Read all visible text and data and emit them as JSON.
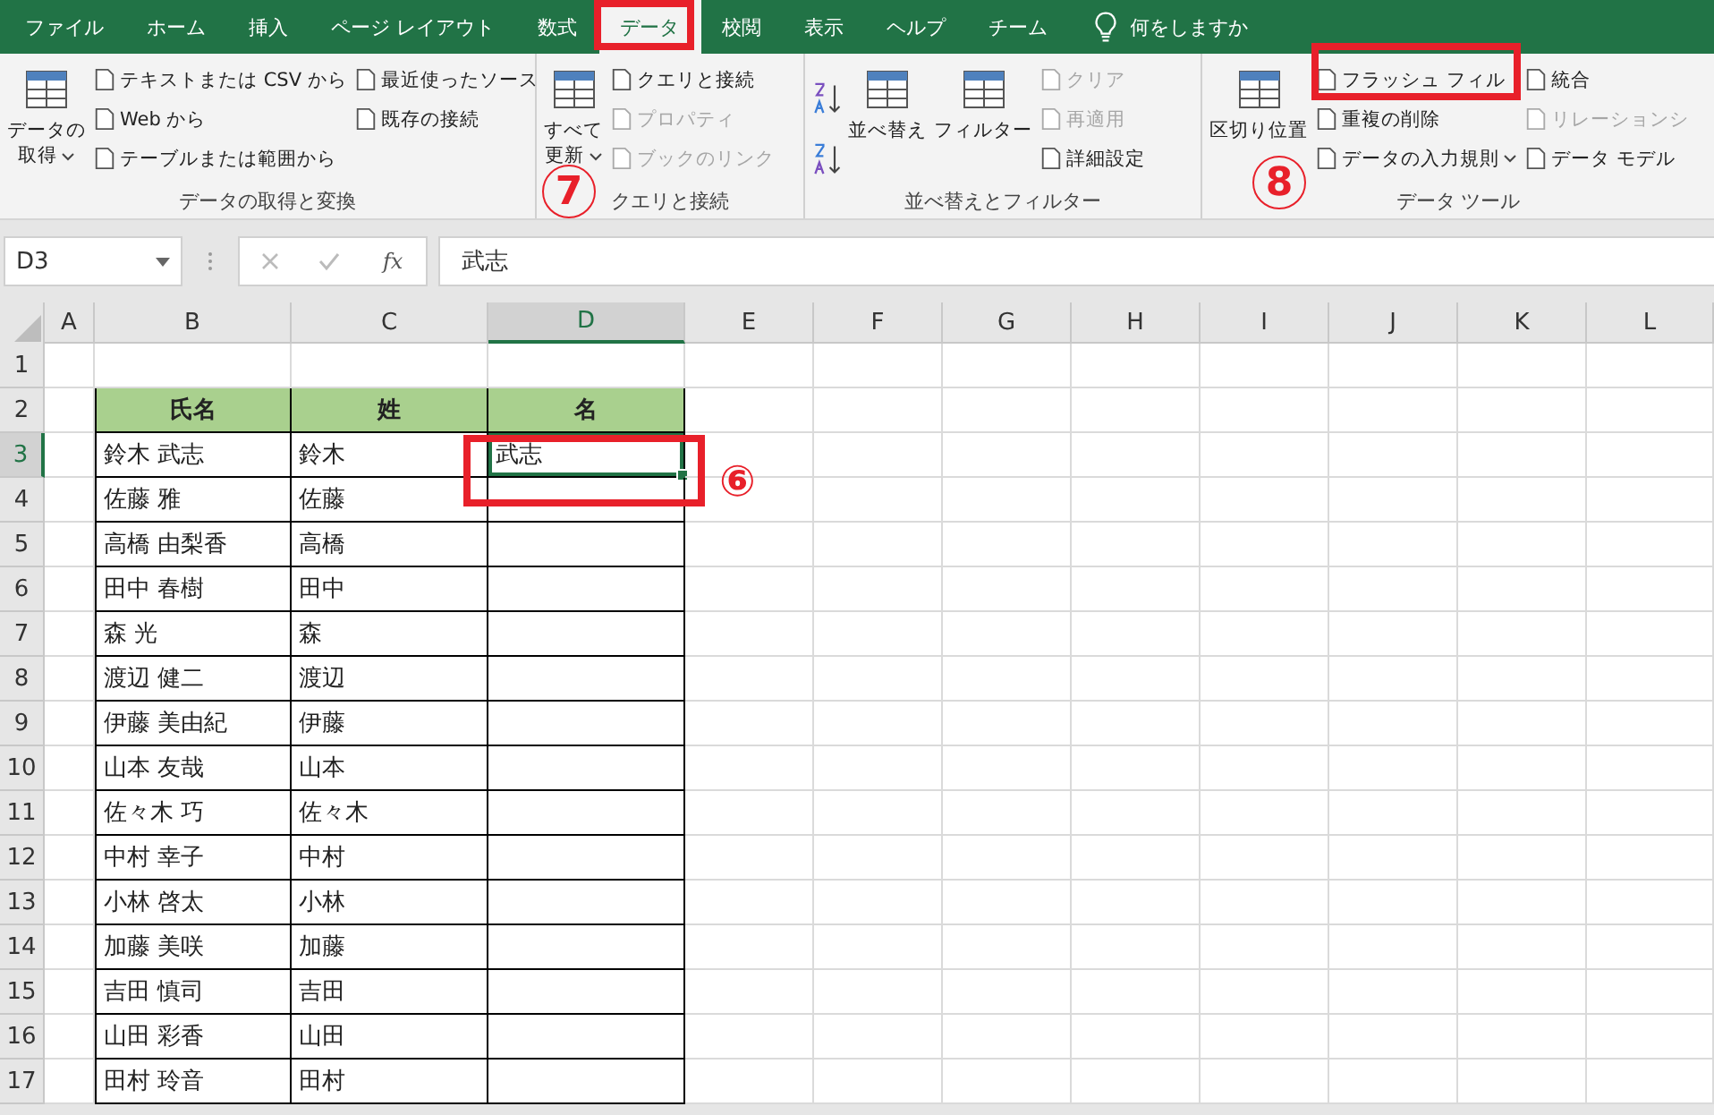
{
  "tabs": [
    {
      "label": "ファイル",
      "selected": false
    },
    {
      "label": "ホーム",
      "selected": false
    },
    {
      "label": "挿入",
      "selected": false
    },
    {
      "label": "ページ レイアウト",
      "selected": false
    },
    {
      "label": "数式",
      "selected": false
    },
    {
      "label": "データ",
      "selected": true
    },
    {
      "label": "校閲",
      "selected": false
    },
    {
      "label": "表示",
      "selected": false
    },
    {
      "label": "ヘルプ",
      "selected": false
    },
    {
      "label": "チーム",
      "selected": false
    }
  ],
  "tell_me": {
    "placeholder": "何をしますか"
  },
  "ribbon": {
    "groups": [
      {
        "label": "データの取得と変換",
        "items": [
          {
            "kind": "large",
            "label_lines": [
              "データの",
              "取得"
            ],
            "dropdown": true,
            "disabled": false
          },
          {
            "kind": "column",
            "entries": [
              {
                "label": "テキストまたは CSV から",
                "disabled": false
              },
              {
                "label": "Web から",
                "disabled": false
              },
              {
                "label": "テーブルまたは範囲から",
                "disabled": false
              }
            ]
          },
          {
            "kind": "column",
            "entries": [
              {
                "label": "最近使ったソース",
                "disabled": false
              },
              {
                "label": "既存の接続",
                "disabled": false
              }
            ]
          }
        ]
      },
      {
        "label": "クエリと接続",
        "items": [
          {
            "kind": "large",
            "label_lines": [
              "すべて",
              "更新"
            ],
            "dropdown": true,
            "disabled": false
          },
          {
            "kind": "column",
            "entries": [
              {
                "label": "クエリと接続",
                "disabled": false
              },
              {
                "label": "プロパティ",
                "disabled": true
              },
              {
                "label": "ブックのリンク",
                "disabled": true
              }
            ]
          }
        ]
      },
      {
        "label": "並べ替えとフィルター",
        "items": [
          {
            "kind": "sort_icons"
          },
          {
            "kind": "large",
            "label_lines": [
              "並べ替え"
            ],
            "dropdown": false,
            "disabled": false
          },
          {
            "kind": "large",
            "label_lines": [
              "フィルター"
            ],
            "dropdown": false,
            "disabled": false
          },
          {
            "kind": "column",
            "entries": [
              {
                "label": "クリア",
                "disabled": true
              },
              {
                "label": "再適用",
                "disabled": true
              },
              {
                "label": "詳細設定",
                "disabled": false
              }
            ]
          }
        ]
      },
      {
        "label": "データ ツール",
        "items": [
          {
            "kind": "large",
            "label_lines": [
              "区切り位置"
            ],
            "dropdown": false,
            "disabled": false
          },
          {
            "kind": "column",
            "entries": [
              {
                "label": "フラッシュ フィル",
                "disabled": false
              },
              {
                "label": "重複の削除",
                "disabled": false
              },
              {
                "label": "データの入力規則",
                "disabled": false,
                "dropdown": true
              }
            ]
          },
          {
            "kind": "column",
            "entries": [
              {
                "label": "統合",
                "disabled": false
              },
              {
                "label": "リレーションシ",
                "disabled": true
              },
              {
                "label": "データ モデル",
                "disabled": false
              }
            ]
          }
        ]
      }
    ]
  },
  "formula_bar": {
    "name_box": "D3",
    "function_label": "fx",
    "value": "武志"
  },
  "sheet": {
    "columns": [
      {
        "label": "A",
        "selected": false
      },
      {
        "label": "B",
        "selected": false
      },
      {
        "label": "C",
        "selected": false
      },
      {
        "label": "D",
        "selected": true
      },
      {
        "label": "E",
        "selected": false
      },
      {
        "label": "F",
        "selected": false
      },
      {
        "label": "G",
        "selected": false
      },
      {
        "label": "H",
        "selected": false
      },
      {
        "label": "I",
        "selected": false
      },
      {
        "label": "J",
        "selected": false
      },
      {
        "label": "K",
        "selected": false
      },
      {
        "label": "L",
        "selected": false
      }
    ],
    "rows": [
      {
        "number": "1",
        "selected": false,
        "kind": "blank",
        "cells": []
      },
      {
        "number": "2",
        "selected": false,
        "kind": "header",
        "cells": [
          "",
          "氏名",
          "姓",
          "名"
        ]
      },
      {
        "number": "3",
        "selected": true,
        "kind": "data",
        "cells": [
          "",
          "鈴木 武志",
          "鈴木",
          "武志"
        ]
      },
      {
        "number": "4",
        "selected": false,
        "kind": "data",
        "cells": [
          "",
          "佐藤 雅",
          "佐藤"
        ]
      },
      {
        "number": "5",
        "selected": false,
        "kind": "data",
        "cells": [
          "",
          "高橋 由梨香",
          "高橋"
        ]
      },
      {
        "number": "6",
        "selected": false,
        "kind": "data",
        "cells": [
          "",
          "田中 春樹",
          "田中"
        ]
      },
      {
        "number": "7",
        "selected": false,
        "kind": "data",
        "cells": [
          "",
          "森 光",
          "森"
        ]
      },
      {
        "number": "8",
        "selected": false,
        "kind": "data",
        "cells": [
          "",
          "渡辺 健二",
          "渡辺"
        ]
      },
      {
        "number": "9",
        "selected": false,
        "kind": "data",
        "cells": [
          "",
          "伊藤 美由紀",
          "伊藤"
        ]
      },
      {
        "number": "10",
        "selected": false,
        "kind": "data",
        "cells": [
          "",
          "山本 友哉",
          "山本"
        ]
      },
      {
        "number": "11",
        "selected": false,
        "kind": "data",
        "cells": [
          "",
          "佐々木 巧",
          "佐々木"
        ]
      },
      {
        "number": "12",
        "selected": false,
        "kind": "data",
        "cells": [
          "",
          "中村 幸子",
          "中村"
        ]
      },
      {
        "number": "13",
        "selected": false,
        "kind": "data",
        "cells": [
          "",
          "小林 啓太",
          "小林"
        ]
      },
      {
        "number": "14",
        "selected": false,
        "kind": "data",
        "cells": [
          "",
          "加藤 美咲",
          "加藤"
        ]
      },
      {
        "number": "15",
        "selected": false,
        "kind": "data",
        "cells": [
          "",
          "吉田 慎司",
          "吉田"
        ]
      },
      {
        "number": "16",
        "selected": false,
        "kind": "data",
        "cells": [
          "",
          "山田 彩香",
          "山田"
        ]
      },
      {
        "number": "17",
        "selected": false,
        "kind": "data",
        "cells": [
          "",
          "田村 玲音",
          "田村"
        ]
      }
    ]
  },
  "annotations": [
    {
      "kind": "circle",
      "label": "7"
    },
    {
      "kind": "circle",
      "label": "8"
    },
    {
      "kind": "glyph",
      "label": "⑥"
    }
  ]
}
